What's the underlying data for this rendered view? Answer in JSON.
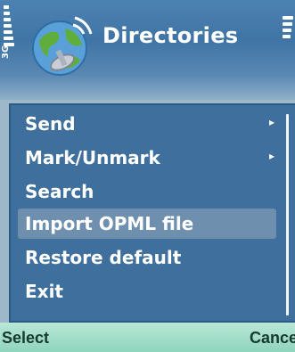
{
  "header": {
    "title": "Directories",
    "network_label": "3G",
    "app_icon": "globe-satellite-icon"
  },
  "menu": {
    "items": [
      {
        "label": "Send",
        "has_submenu": true,
        "submenu_icon": "chevron-right-icon"
      },
      {
        "label": "Mark/Unmark",
        "has_submenu": true,
        "submenu_icon": "chevron-right-icon"
      },
      {
        "label": "Search",
        "has_submenu": false
      },
      {
        "label": "Import OPML file",
        "has_submenu": false,
        "highlighted": true
      },
      {
        "label": "Restore default",
        "has_submenu": false
      },
      {
        "label": "Exit",
        "has_submenu": false
      }
    ],
    "highlight_color": "#6f8fae",
    "background_color": "#3f6f9c"
  },
  "softkeys": {
    "left": "Select",
    "right": "Cance"
  }
}
